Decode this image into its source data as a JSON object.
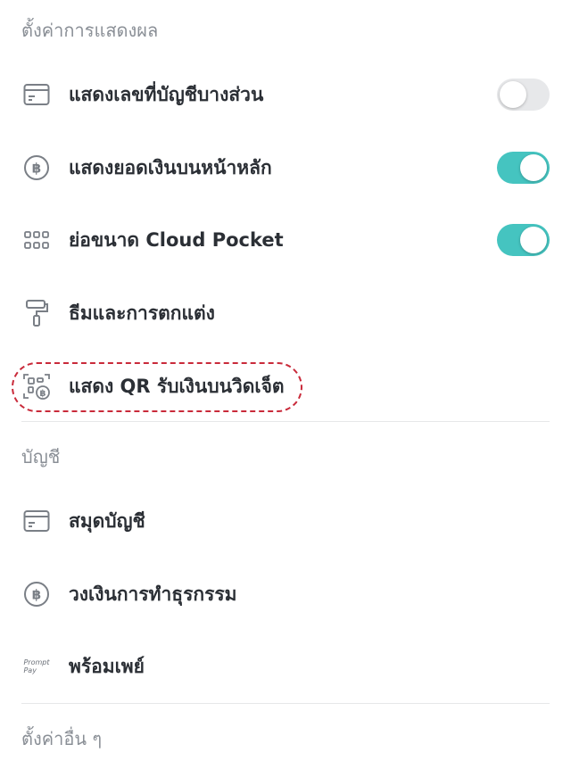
{
  "display_settings": {
    "header": "ตั้งค่าการแสดงผล",
    "items": [
      {
        "label": "แสดงเลขที่บัญชีบางส่วน",
        "icon": "card-icon",
        "toggle": "off"
      },
      {
        "label": "แสดงยอดเงินบนหน้าหลัก",
        "icon": "baht-circle-icon",
        "toggle": "on"
      },
      {
        "label": "ย่อขนาด Cloud Pocket",
        "icon": "grid-dots-icon",
        "toggle": "on"
      },
      {
        "label": "ธีมและการตกแต่ง",
        "icon": "paint-roller-icon"
      },
      {
        "label": "แสดง QR รับเงินบนวิดเจ็ต",
        "icon": "qr-baht-icon",
        "highlighted": true
      }
    ]
  },
  "account": {
    "header": "บัญชี",
    "items": [
      {
        "label": "สมุดบัญชี",
        "icon": "card-icon"
      },
      {
        "label": "วงเงินการทำธุรกรรม",
        "icon": "baht-circle-icon"
      },
      {
        "label": "พร้อมเพย์",
        "icon": "promptpay-logo",
        "logo_text": [
          "Prompt",
          "Pay"
        ]
      }
    ]
  },
  "other_settings": {
    "header": "ตั้งค่าอื่น ๆ"
  },
  "colors": {
    "toggle_on": "#45c4c0",
    "toggle_off": "#e7e8ea",
    "highlight": "#c92a3a"
  }
}
